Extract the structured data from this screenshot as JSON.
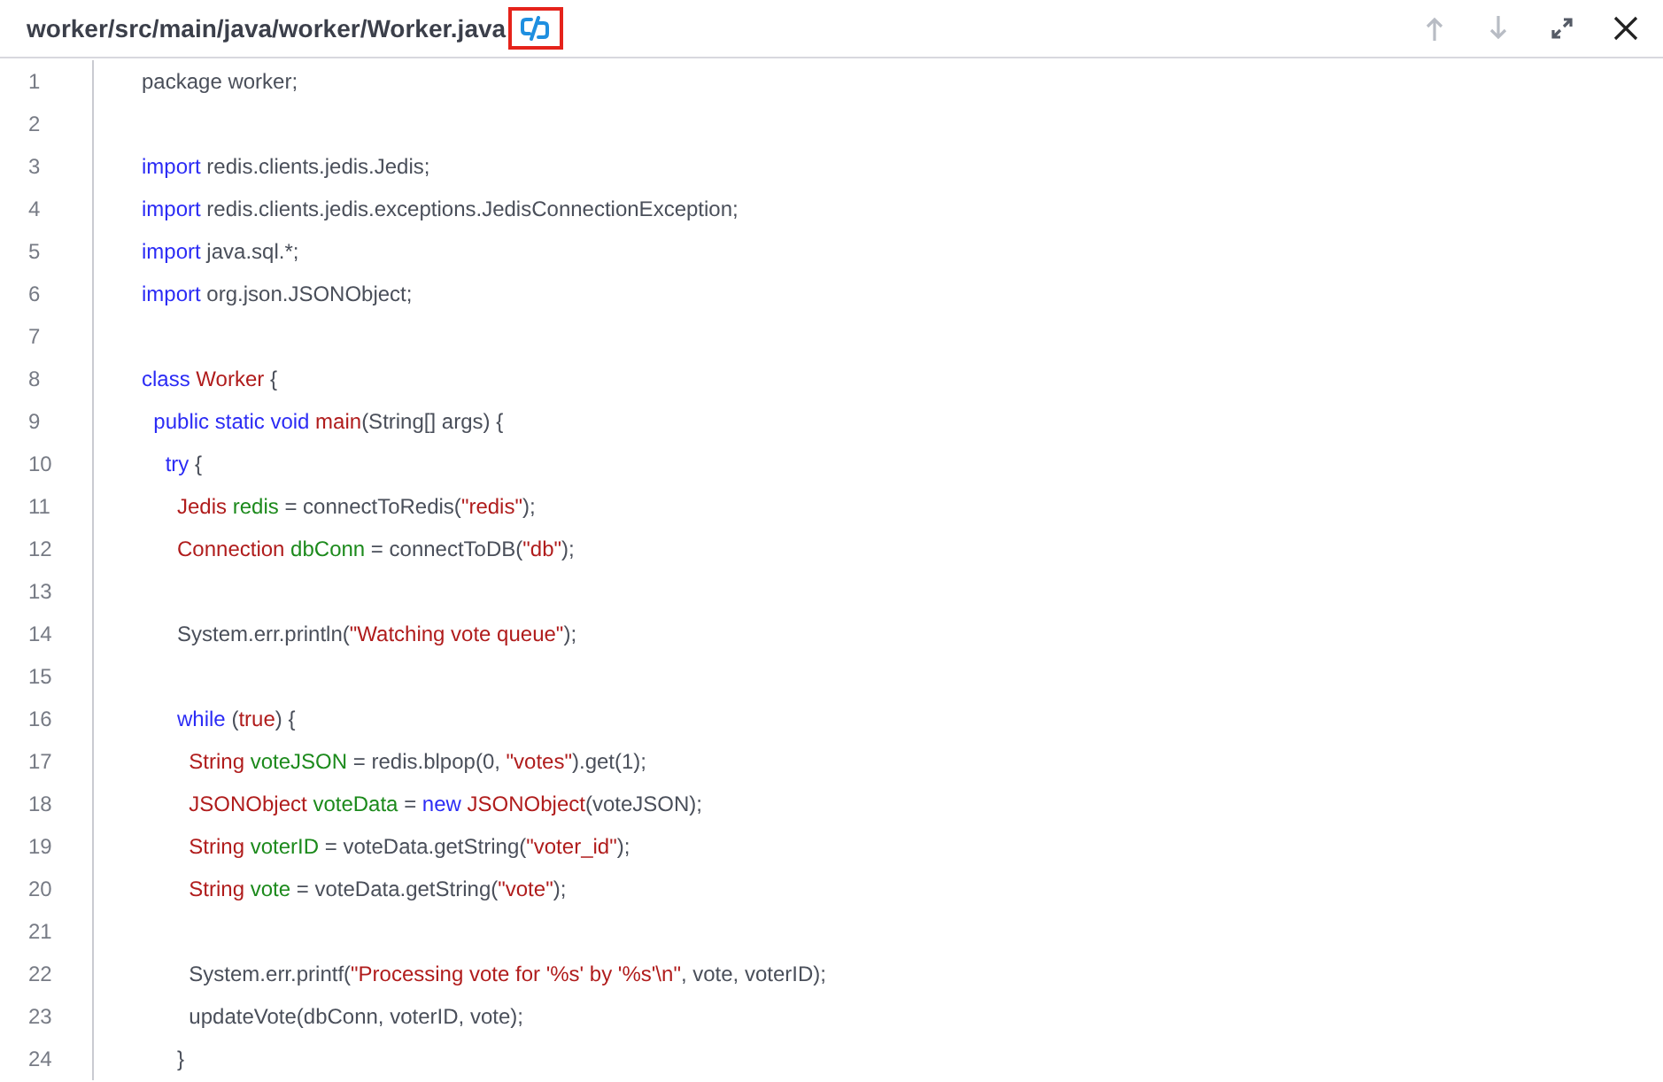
{
  "header": {
    "title": "worker/src/main/java/worker/Worker.java",
    "actions": [
      {
        "kind": "up",
        "disabled": true
      },
      {
        "kind": "down",
        "disabled": true
      },
      {
        "kind": "expand",
        "disabled": false
      },
      {
        "kind": "close",
        "disabled": false
      }
    ]
  },
  "code": {
    "lines": [
      {
        "number": "1",
        "tokens": [
          {
            "kind": "plain",
            "text": "package worker;"
          }
        ]
      },
      {
        "number": "2"
      },
      {
        "number": "3",
        "tokens": [
          {
            "kind": "keyword",
            "text": "import"
          },
          {
            "kind": "plain",
            "text": " redis.clients.jedis.Jedis;"
          }
        ]
      },
      {
        "number": "4",
        "tokens": [
          {
            "kind": "keyword",
            "text": "import"
          },
          {
            "kind": "plain",
            "text": " redis.clients.jedis.exceptions.JedisConnectionException;"
          }
        ]
      },
      {
        "number": "5",
        "tokens": [
          {
            "kind": "keyword",
            "text": "import"
          },
          {
            "kind": "plain",
            "text": " java.sql.*;"
          }
        ]
      },
      {
        "number": "6",
        "tokens": [
          {
            "kind": "keyword",
            "text": "import"
          },
          {
            "kind": "plain",
            "text": " org.json.JSONObject;"
          }
        ]
      },
      {
        "number": "7"
      },
      {
        "number": "8",
        "tokens": [
          {
            "kind": "keyword",
            "text": "class"
          },
          {
            "kind": "type",
            "text": " Worker"
          },
          {
            "kind": "plain",
            "text": " {"
          }
        ]
      },
      {
        "number": "9",
        "tokens": [
          {
            "kind": "keyword",
            "text": "  public static void"
          },
          {
            "kind": "type",
            "text": " main"
          },
          {
            "kind": "plain",
            "text": "(String[] args) {"
          }
        ]
      },
      {
        "number": "10",
        "tokens": [
          {
            "kind": "keyword",
            "text": "    try"
          },
          {
            "kind": "plain",
            "text": " {"
          }
        ]
      },
      {
        "number": "11",
        "tokens": [
          {
            "kind": "type",
            "text": "      Jedis"
          },
          {
            "kind": "variable",
            "text": " redis"
          },
          {
            "kind": "plain",
            "text": " = connectToRedis("
          },
          {
            "kind": "string",
            "text": "\"redis\""
          },
          {
            "kind": "plain",
            "text": ");"
          }
        ]
      },
      {
        "number": "12",
        "tokens": [
          {
            "kind": "type",
            "text": "      Connection"
          },
          {
            "kind": "variable",
            "text": " dbConn"
          },
          {
            "kind": "plain",
            "text": " = connectToDB("
          },
          {
            "kind": "string",
            "text": "\"db\""
          },
          {
            "kind": "plain",
            "text": ");"
          }
        ]
      },
      {
        "number": "13"
      },
      {
        "number": "14",
        "tokens": [
          {
            "kind": "plain",
            "text": "      System.err.println("
          },
          {
            "kind": "string",
            "text": "\"Watching vote queue\""
          },
          {
            "kind": "plain",
            "text": ");"
          }
        ]
      },
      {
        "number": "15"
      },
      {
        "number": "16",
        "tokens": [
          {
            "kind": "keyword",
            "text": "      while"
          },
          {
            "kind": "plain",
            "text": " ("
          },
          {
            "kind": "type",
            "text": "true"
          },
          {
            "kind": "plain",
            "text": ") {"
          }
        ]
      },
      {
        "number": "17",
        "tokens": [
          {
            "kind": "type",
            "text": "        String"
          },
          {
            "kind": "variable",
            "text": " voteJSON"
          },
          {
            "kind": "plain",
            "text": " = redis.blpop(0, "
          },
          {
            "kind": "string",
            "text": "\"votes\""
          },
          {
            "kind": "plain",
            "text": ").get(1);"
          }
        ]
      },
      {
        "number": "18",
        "tokens": [
          {
            "kind": "type",
            "text": "        JSONObject"
          },
          {
            "kind": "variable",
            "text": " voteData"
          },
          {
            "kind": "plain",
            "text": " = "
          },
          {
            "kind": "keyword",
            "text": "new"
          },
          {
            "kind": "type",
            "text": " JSONObject"
          },
          {
            "kind": "plain",
            "text": "(voteJSON);"
          }
        ]
      },
      {
        "number": "19",
        "tokens": [
          {
            "kind": "type",
            "text": "        String"
          },
          {
            "kind": "variable",
            "text": " voterID"
          },
          {
            "kind": "plain",
            "text": " = voteData.getString("
          },
          {
            "kind": "string",
            "text": "\"voter_id\""
          },
          {
            "kind": "plain",
            "text": ");"
          }
        ]
      },
      {
        "number": "20",
        "tokens": [
          {
            "kind": "type",
            "text": "        String"
          },
          {
            "kind": "variable",
            "text": " vote"
          },
          {
            "kind": "plain",
            "text": " = voteData.getString("
          },
          {
            "kind": "string",
            "text": "\"vote\""
          },
          {
            "kind": "plain",
            "text": ");"
          }
        ]
      },
      {
        "number": "21"
      },
      {
        "number": "22",
        "tokens": [
          {
            "kind": "plain",
            "text": "        System.err.printf("
          },
          {
            "kind": "string",
            "text": "\"Processing vote for '%s' by '%s'\\n\""
          },
          {
            "kind": "plain",
            "text": ", vote, voterID);"
          }
        ]
      },
      {
        "number": "23",
        "tokens": [
          {
            "kind": "plain",
            "text": "        updateVote(dbConn, voterID, vote);"
          }
        ]
      },
      {
        "number": "24",
        "tokens": [
          {
            "kind": "plain",
            "text": "      }"
          }
        ]
      }
    ]
  }
}
